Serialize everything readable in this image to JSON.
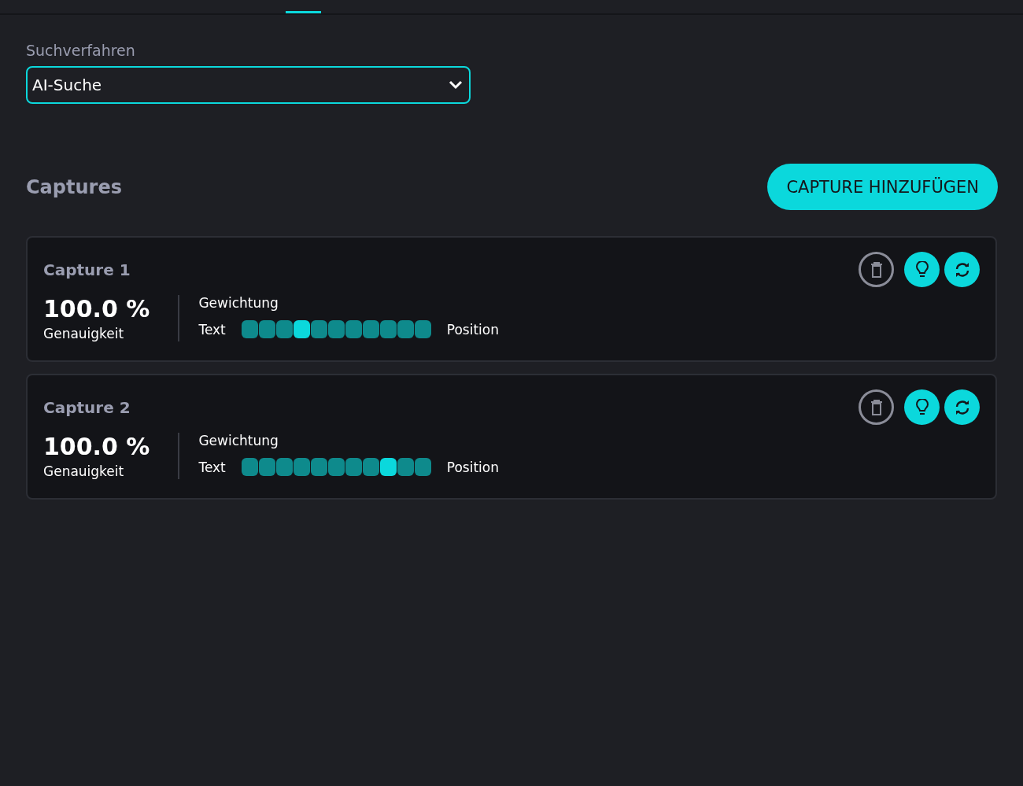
{
  "search_method": {
    "label": "Suchverfahren",
    "value": "AI-Suche"
  },
  "captures_section": {
    "title": "Captures",
    "add_button": "CAPTURE HINZUFÜGEN"
  },
  "captures": [
    {
      "title": "Capture 1",
      "accuracy": "100.0 %",
      "accuracy_label": "Genauigkeit",
      "weighting_label": "Gewichtung",
      "left_label": "Text",
      "right_label": "Position",
      "level": 0.3
    },
    {
      "title": "Capture 2",
      "accuracy": "100.0 %",
      "accuracy_label": "Genauigkeit",
      "weighting_label": "Gewichtung",
      "left_label": "Text",
      "right_label": "Position",
      "level": 0.8
    }
  ]
}
